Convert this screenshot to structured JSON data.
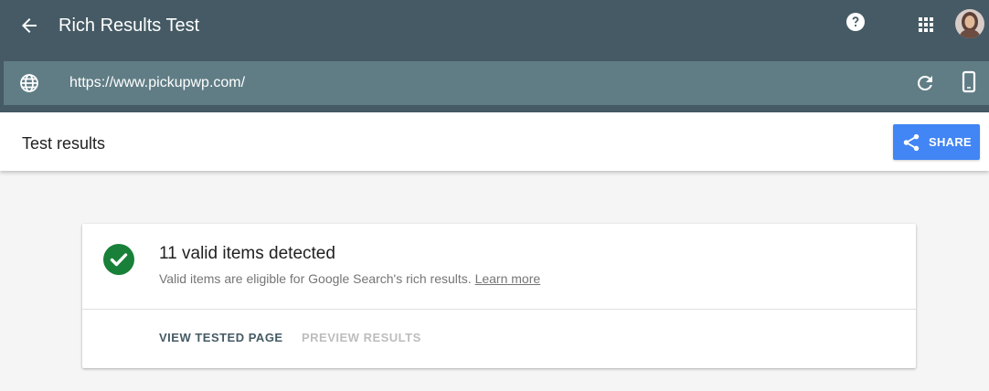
{
  "app": {
    "title": "Rich Results Test",
    "url": "https://www.pickupwp.com/"
  },
  "results": {
    "title": "Test results",
    "share_label": "SHARE"
  },
  "card": {
    "heading": "11 valid items detected",
    "subtitle": "Valid items are eligible for Google Search's rich results.",
    "learn_more": "Learn more",
    "view_tested_page": "VIEW TESTED PAGE",
    "preview_results": "PREVIEW RESULTS"
  },
  "icons": {
    "back": "arrow-back-icon",
    "help": "help-icon",
    "apps": "apps-grid-icon",
    "globe": "globe-icon",
    "refresh": "refresh-icon",
    "device": "smartphone-icon",
    "share": "share-icon",
    "check": "check-circle-icon"
  },
  "colors": {
    "appbar": "#455a64",
    "urlbar": "#607d85",
    "share_button": "#4285f4",
    "success": "#188038"
  }
}
